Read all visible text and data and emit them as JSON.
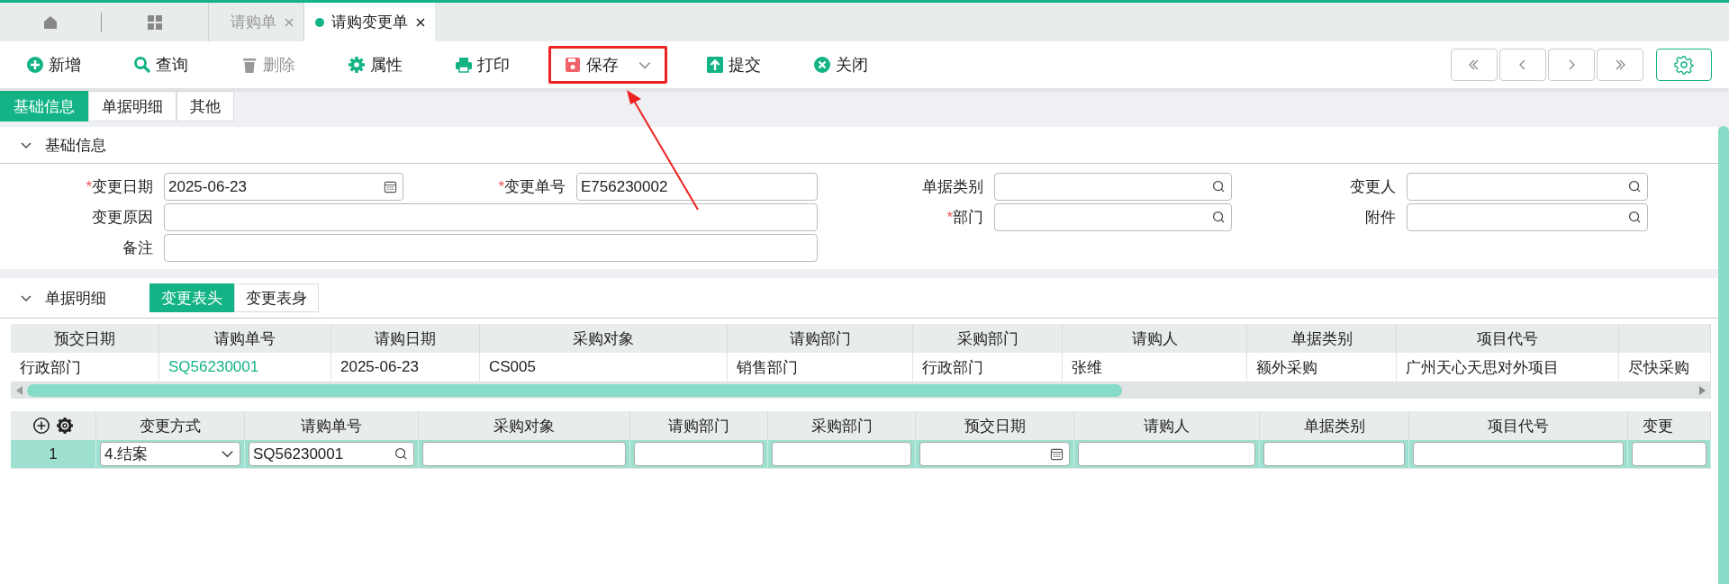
{
  "doc_tabs": [
    {
      "label": "请购单",
      "selected": false
    },
    {
      "label": "请购变更单",
      "selected": true
    }
  ],
  "toolbar": [
    {
      "label": "新增",
      "disabled": false,
      "dropdown": false,
      "annotated": false
    },
    {
      "label": "查询",
      "disabled": false,
      "dropdown": false,
      "annotated": false
    },
    {
      "label": "删除",
      "disabled": true,
      "dropdown": false,
      "annotated": false
    },
    {
      "label": "属性",
      "disabled": false,
      "dropdown": false,
      "annotated": false
    },
    {
      "label": "打印",
      "disabled": false,
      "dropdown": false,
      "annotated": false
    },
    {
      "label": "保存",
      "disabled": false,
      "dropdown": true,
      "annotated": true
    },
    {
      "label": "提交",
      "disabled": false,
      "dropdown": false,
      "annotated": false
    },
    {
      "label": "关闭",
      "disabled": false,
      "dropdown": false,
      "annotated": false
    }
  ],
  "view_tabs": [
    {
      "label": "基础信息",
      "selected": true
    },
    {
      "label": "单据明细",
      "selected": false
    },
    {
      "label": "其他",
      "selected": false
    }
  ],
  "basic_section": {
    "title": "基础信息",
    "expanded": true,
    "rows": [
      [
        {
          "label": "变更日期",
          "required_mark": "*",
          "kind": "date",
          "value": "2025-06-23",
          "wide": false
        },
        {
          "label": "变更单号",
          "required_mark": "*",
          "kind": "text",
          "value": "E756230002",
          "wide": false
        },
        {
          "label": "单据类别",
          "kind": "lookup",
          "wide": false
        },
        {
          "label": "变更人",
          "kind": "lookup",
          "wide": false
        }
      ],
      [
        {
          "label": "变更原因",
          "kind": "text",
          "wide": true
        },
        "",
        {
          "label": "部门",
          "required_mark": "*",
          "kind": "lookup",
          "wide": false
        },
        {
          "label": "附件",
          "kind": "lookup",
          "wide": false
        }
      ],
      [
        {
          "label": "备注",
          "kind": "text",
          "wide": true
        },
        ""
      ]
    ]
  },
  "detail_section": {
    "title": "单据明细",
    "expanded": true,
    "tabs": [
      {
        "label": "变更表头",
        "selected": true
      },
      {
        "label": "变更表身",
        "selected": false
      }
    ],
    "header_table": {
      "columns": [
        "预交日期",
        "请购单号",
        "请购日期",
        "采购对象",
        "请购部门",
        "采购部门",
        "请购人",
        "单据类别",
        "项目代号"
      ],
      "rows": [
        {
          "cells": [
            {
              "kind": "text",
              "text": "行政部门"
            },
            {
              "kind": "link",
              "text": "SQ56230001"
            },
            {
              "kind": "text",
              "text": "2025-06-23"
            },
            {
              "kind": "text",
              "text": "CS005"
            },
            {
              "kind": "text",
              "text": "销售部门"
            },
            {
              "kind": "text",
              "text": "行政部门"
            },
            {
              "kind": "text",
              "text": "张维"
            },
            {
              "kind": "text",
              "text": "额外采购"
            },
            {
              "kind": "text",
              "text": "广州天心天思对外项目"
            },
            {
              "kind": "text",
              "text": "尽快采购"
            }
          ]
        }
      ]
    },
    "body_table": {
      "columns": [
        "变更方式",
        "请购单号",
        "采购对象",
        "请购部门",
        "采购部门",
        "预交日期",
        "请购人",
        "单据类别",
        "项目代号",
        "变更"
      ],
      "rows": [
        {
          "number": "1",
          "selected": true,
          "cells": [
            {
              "kind": "select",
              "value": "4.结案"
            },
            {
              "kind": "lookup",
              "value": "SQ56230001"
            },
            {
              "kind": "text"
            },
            {
              "kind": "text"
            },
            {
              "kind": "text"
            },
            {
              "kind": "date"
            },
            {
              "kind": "text"
            },
            {
              "kind": "text"
            },
            {
              "kind": "text"
            },
            {
              "kind": "text"
            }
          ]
        }
      ]
    }
  }
}
